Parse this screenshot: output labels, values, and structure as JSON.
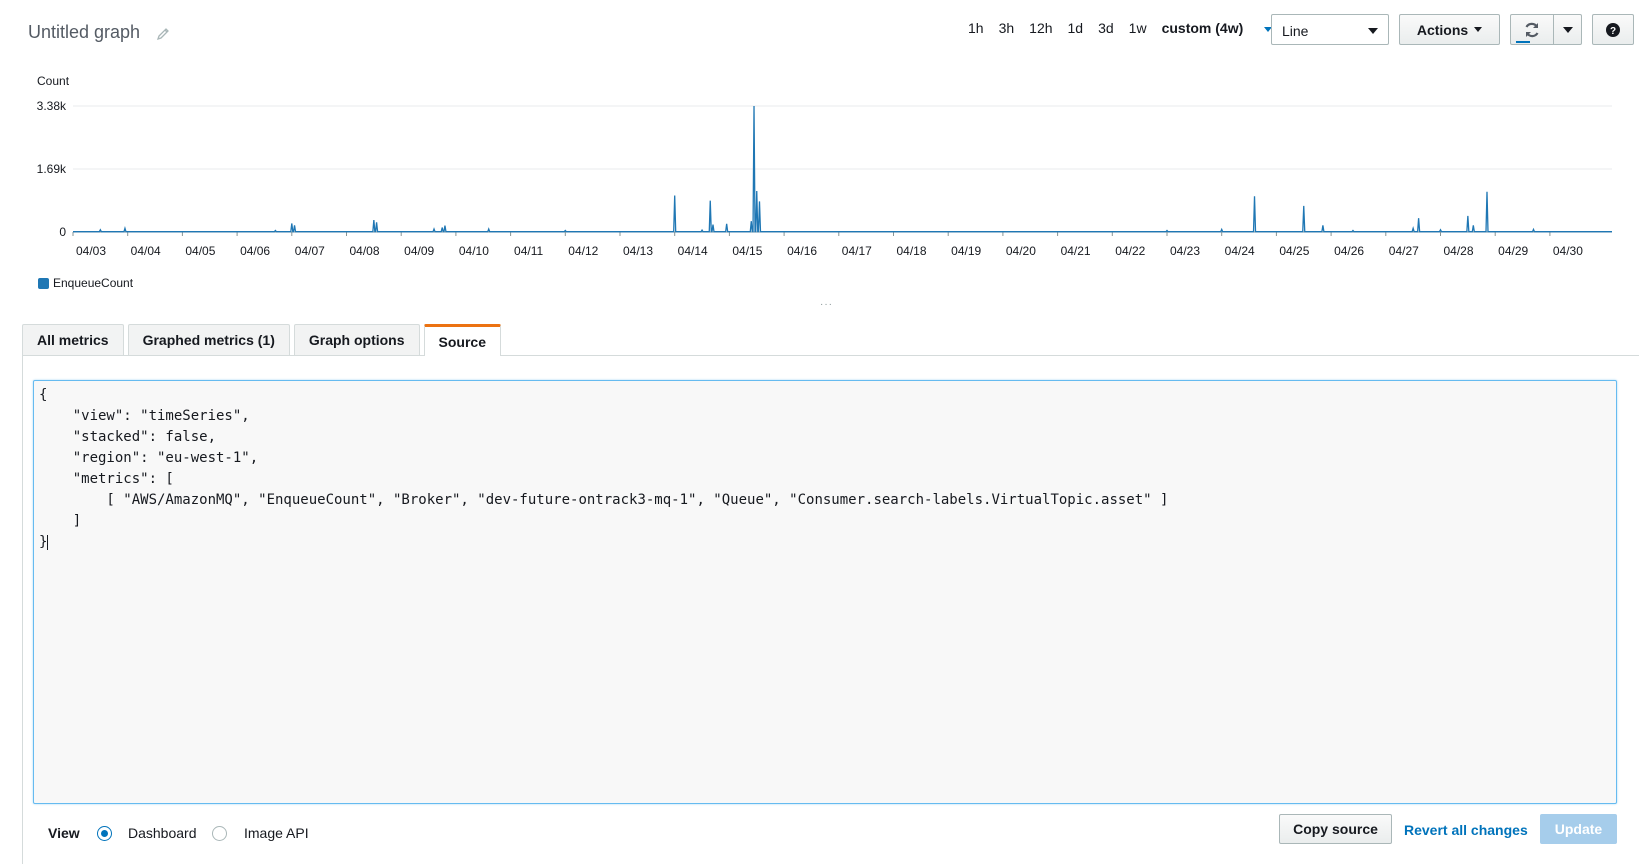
{
  "header": {
    "title": "Untitled graph",
    "time_ranges": [
      "1h",
      "3h",
      "12h",
      "1d",
      "3d",
      "1w"
    ],
    "custom_range": "custom (4w)",
    "graph_type": "Line",
    "actions_label": "Actions",
    "help_label": "?"
  },
  "chart_data": {
    "type": "line",
    "title": "",
    "ylabel": "Count",
    "yticks": [
      "0",
      "1.69k",
      "3.38k"
    ],
    "ylim": [
      0,
      3380
    ],
    "xticks": [
      "04/03",
      "04/04",
      "04/05",
      "04/06",
      "04/07",
      "04/08",
      "04/09",
      "04/10",
      "04/11",
      "04/12",
      "04/13",
      "04/14",
      "04/15",
      "04/16",
      "04/17",
      "04/18",
      "04/19",
      "04/20",
      "04/21",
      "04/22",
      "04/23",
      "04/24",
      "04/25",
      "04/26",
      "04/27",
      "04/28",
      "04/29",
      "04/30"
    ],
    "x_start": "04/03",
    "legend_position": "bottom-left",
    "color": "#1f77b4",
    "series": [
      {
        "name": "EnqueueCount",
        "points": [
          [
            0.5,
            60
          ],
          [
            0.95,
            100
          ],
          [
            3.7,
            40
          ],
          [
            4.0,
            230
          ],
          [
            4.05,
            180
          ],
          [
            5.5,
            320
          ],
          [
            5.55,
            260
          ],
          [
            6.6,
            80
          ],
          [
            6.75,
            120
          ],
          [
            6.8,
            170
          ],
          [
            7.6,
            80
          ],
          [
            9.0,
            40
          ],
          [
            11.0,
            980
          ],
          [
            11.5,
            50
          ],
          [
            11.65,
            840
          ],
          [
            11.7,
            200
          ],
          [
            11.95,
            220
          ],
          [
            12.4,
            290
          ],
          [
            12.45,
            3380
          ],
          [
            12.5,
            1100
          ],
          [
            12.55,
            820
          ],
          [
            20.0,
            40
          ],
          [
            21.0,
            70
          ],
          [
            21.6,
            960
          ],
          [
            22.5,
            700
          ],
          [
            22.85,
            180
          ],
          [
            23.4,
            40
          ],
          [
            24.5,
            100
          ],
          [
            24.6,
            370
          ],
          [
            25.0,
            60
          ],
          [
            25.5,
            430
          ],
          [
            25.6,
            180
          ],
          [
            25.85,
            1080
          ],
          [
            26.7,
            70
          ]
        ]
      }
    ]
  },
  "tabs": [
    {
      "label": "All metrics",
      "active": false
    },
    {
      "label": "Graphed metrics (1)",
      "active": false
    },
    {
      "label": "Graph options",
      "active": false
    },
    {
      "label": "Source",
      "active": true
    }
  ],
  "source": {
    "lines": [
      "{",
      "    \"view\": \"timeSeries\",",
      "    \"stacked\": false,",
      "    \"region\": \"eu-west-1\",",
      "    \"metrics\": [",
      "        [ \"AWS/AmazonMQ\", \"EnqueueCount\", \"Broker\", \"dev-future-ontrack3-mq-1\", \"Queue\", \"Consumer.search-labels.VirtualTopic.asset\" ]",
      "    ]",
      "}"
    ]
  },
  "footer": {
    "view_label": "View",
    "options": [
      "Dashboard",
      "Image API"
    ],
    "selected": "Dashboard",
    "copy_label": "Copy source",
    "revert_label": "Revert all changes",
    "update_label": "Update"
  }
}
